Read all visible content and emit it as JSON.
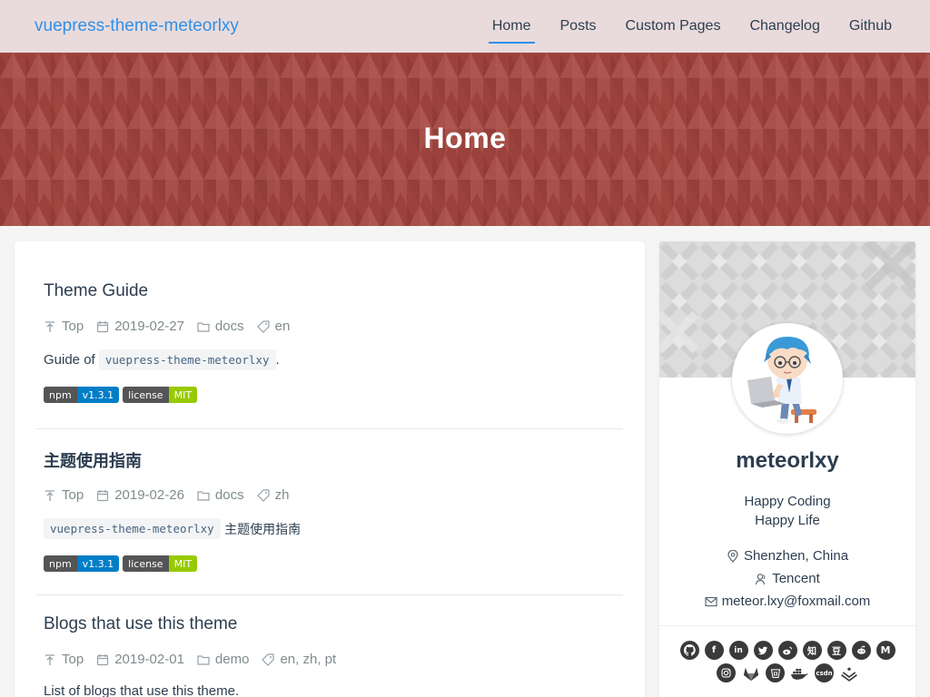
{
  "navbar": {
    "brand": "vuepress-theme-meteorlxy",
    "links": [
      {
        "label": "Home",
        "active": true
      },
      {
        "label": "Posts",
        "active": false
      },
      {
        "label": "Custom Pages",
        "active": false
      },
      {
        "label": "Changelog",
        "active": false
      },
      {
        "label": "Github",
        "active": false
      }
    ]
  },
  "hero": {
    "title": "Home"
  },
  "posts": [
    {
      "title": "Theme Guide",
      "sticky": "Top",
      "date": "2019-02-27",
      "category": "docs",
      "tags": "en",
      "excerpt_before": "Guide of ",
      "excerpt_code": "vuepress-theme-meteorlxy",
      "excerpt_after": ".",
      "badges": [
        {
          "label": "npm",
          "value": "v1.3.1",
          "color": "#007ec6"
        },
        {
          "label": "license",
          "value": "MIT",
          "color": "#97ca00"
        }
      ]
    },
    {
      "title": "主题使用指南",
      "sticky": "Top",
      "date": "2019-02-26",
      "category": "docs",
      "tags": "zh",
      "excerpt_before": "",
      "excerpt_code": "vuepress-theme-meteorlxy",
      "excerpt_after": " 主题使用指南",
      "badges": [
        {
          "label": "npm",
          "value": "v1.3.1",
          "color": "#007ec6"
        },
        {
          "label": "license",
          "value": "MIT",
          "color": "#97ca00"
        }
      ]
    },
    {
      "title": "Blogs that use this theme",
      "sticky": "Top",
      "date": "2019-02-01",
      "category": "demo",
      "tags": "en, zh, pt",
      "excerpt_before": "List of blogs that use this theme.",
      "excerpt_code": "",
      "excerpt_after": ""
    }
  ],
  "profile": {
    "name": "meteorlxy",
    "motto_line1": "Happy Coding",
    "motto_line2": "Happy Life",
    "location": "Shenzhen, China",
    "organization": "Tencent",
    "email": "meteor.lxy@foxmail.com",
    "social_row1": [
      "github-icon",
      "facebook-icon",
      "linkedin-icon",
      "twitter-icon",
      "weibo-icon",
      "zhihu-icon",
      "douban-icon",
      "reddit-icon",
      "medium-icon"
    ],
    "social_row2": [
      "instagram-icon",
      "gitlab-icon",
      "bitbucket-icon",
      "docker-icon",
      "csdn-icon",
      "juejin-icon"
    ],
    "social_glyphs": {
      "zhihu": "知",
      "douban": "豆",
      "medium": "M",
      "csdn": "csdn"
    }
  },
  "colors": {
    "accent": "#2f8fe8",
    "hero_bg": "#9b403b",
    "badge_blue": "#007ec6",
    "badge_green": "#97ca00"
  }
}
